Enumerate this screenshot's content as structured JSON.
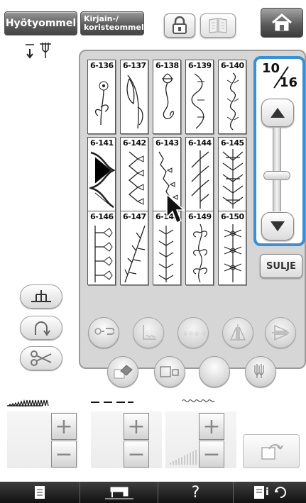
{
  "tabs": {
    "utility_label": "Hyötyommel",
    "decorative_label": "Kirjain-/\nkoristeommel"
  },
  "page_indicator": {
    "current": "10",
    "total": "16"
  },
  "close_label": "SULJE",
  "help_label": "?",
  "stitches": [
    {
      "code": "6-136"
    },
    {
      "code": "6-137"
    },
    {
      "code": "6-138"
    },
    {
      "code": "6-139"
    },
    {
      "code": "6-140"
    },
    {
      "code": "6-141"
    },
    {
      "code": "6-142"
    },
    {
      "code": "6-143"
    },
    {
      "code": "6-144"
    },
    {
      "code": "6-145"
    },
    {
      "code": "6-146"
    },
    {
      "code": "6-147"
    },
    {
      "code": "6-148"
    },
    {
      "code": "6-149"
    },
    {
      "code": "6-150"
    }
  ],
  "scroll_position": 0.55,
  "colors": {
    "active_border": "#3a8fd6",
    "panel_bg": "#d6d6d6",
    "top_bar_dark": "#444444",
    "bottom_bar": "#1a1a1a"
  },
  "icons": [
    "lock-icon",
    "book-icon",
    "home-icon",
    "needle-position-icon",
    "presser-foot-icon",
    "needle-mode-icon",
    "scissors-icon",
    "stitch-edit-icon",
    "sew-repeat-icon",
    "stitch-pattern-icon",
    "mirror-vertical-icon",
    "mirror-horizontal-icon",
    "eraser-icon",
    "size-icon",
    "blank-circle-icon",
    "twin-needle-icon",
    "width-icon",
    "length-icon",
    "density-icon",
    "return-icon",
    "page-icon",
    "sewing-machine-icon",
    "help-icon",
    "settings-icon"
  ]
}
